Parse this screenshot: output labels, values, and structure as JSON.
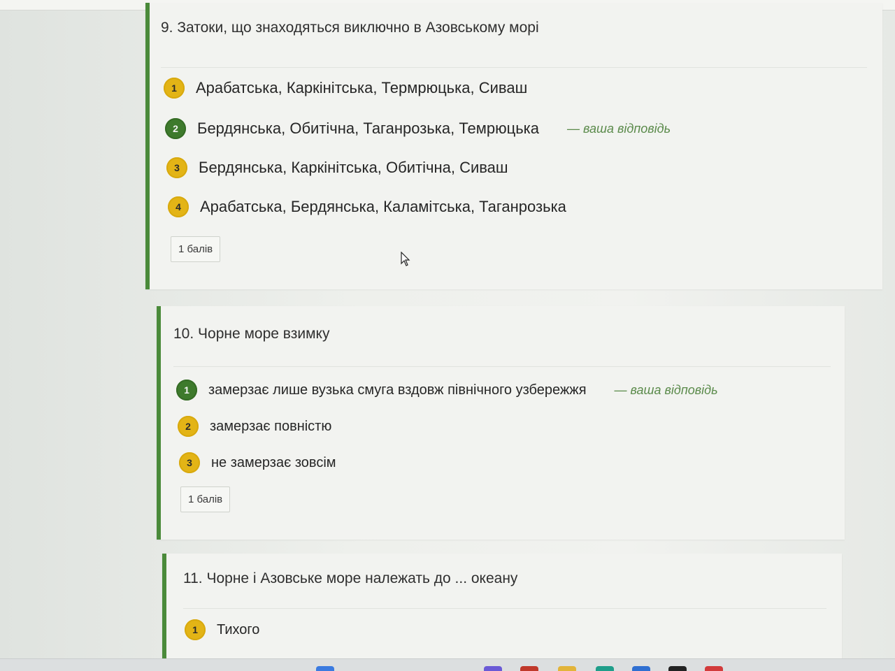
{
  "questions": [
    {
      "title": "9. Затоки, що знаходяться виключно в Азовському морі",
      "options": [
        {
          "num": "1",
          "text": "Арабатська, Каркінітська, Термрюцька, Сиваш",
          "state": "normal"
        },
        {
          "num": "2",
          "text": "Бердянська, Обитічна, Таганрозька, Темрюцька",
          "state": "selected",
          "answer_note": "— ваша відповідь"
        },
        {
          "num": "3",
          "text": "Бердянська, Каркінітська, Обитічна, Сиваш",
          "state": "normal"
        },
        {
          "num": "4",
          "text": "Арабатська, Бердянська, Каламітська, Таганрозька",
          "state": "normal"
        }
      ],
      "points": "1 балів"
    },
    {
      "title": "10. Чорне море взимку",
      "options": [
        {
          "num": "1",
          "text": "замерзає лише вузька смуга вздовж північного узбережжя",
          "state": "selected",
          "answer_note": "— ваша відповідь"
        },
        {
          "num": "2",
          "text": "замерзає повністю",
          "state": "normal"
        },
        {
          "num": "3",
          "text": "не замерзає зовсім",
          "state": "normal"
        }
      ],
      "points": "1 балів"
    },
    {
      "title": "11. Чорне і Азовське море належать до ... океану",
      "options": [
        {
          "num": "1",
          "text": "Тихого",
          "state": "normal"
        }
      ]
    }
  ],
  "colors": {
    "accent_green": "#4a8a3a",
    "selected_badge": "#3e7a2c",
    "option_badge": "#e3b416",
    "answer_note": "#5a8a4a"
  },
  "icons": {
    "cursor": "mouse-pointer-icon",
    "taskbar": [
      "browser-icon",
      "mail-icon",
      "folder-icon",
      "edge-icon",
      "store-icon",
      "chrome-icon",
      "opera-icon"
    ]
  }
}
